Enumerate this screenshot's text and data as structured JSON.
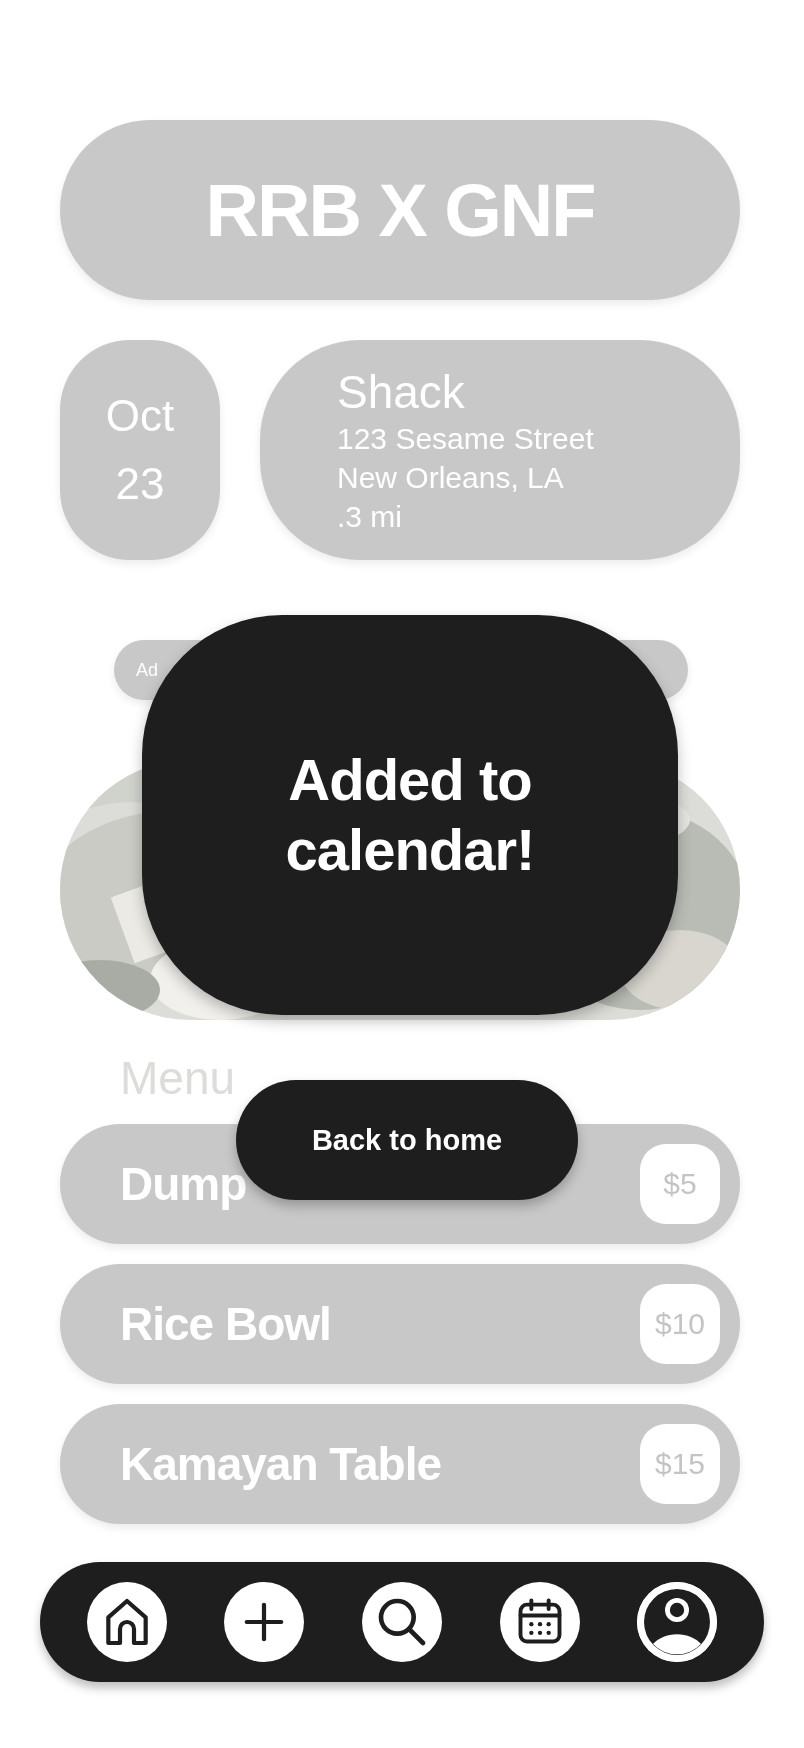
{
  "event": {
    "title": "RRB X GNF"
  },
  "date": {
    "month": "Oct",
    "day": "23"
  },
  "venue": {
    "name": "Shack",
    "street": "123 Sesame Street",
    "city": "New Orleans, LA",
    "distance": ".3 mi"
  },
  "action_button": {
    "label": "Ad"
  },
  "menu": {
    "heading": "Menu",
    "items": [
      {
        "name": "Dump",
        "price": "$5"
      },
      {
        "name": "Rice Bowl",
        "price": "$10"
      },
      {
        "name": "Kamayan Table",
        "price": "$15"
      }
    ]
  },
  "dialog": {
    "message": "Added to calendar!",
    "button": "Back to home"
  },
  "nav": [
    {
      "kind": "home"
    },
    {
      "kind": "add"
    },
    {
      "kind": "search"
    },
    {
      "kind": "calendar"
    },
    {
      "kind": "profile"
    }
  ]
}
